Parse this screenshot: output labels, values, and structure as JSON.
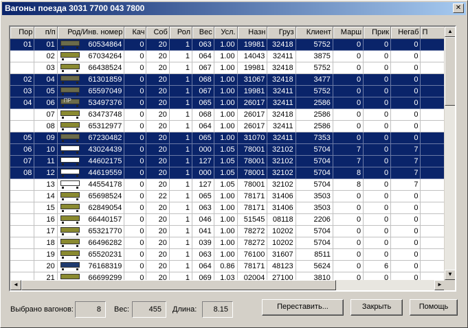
{
  "window": {
    "title": "Вагоны поезда   3031  7700 043 7800",
    "close_glyph": "✕"
  },
  "columns": [
    "Пор",
    "п/п",
    "Род/Инв. номер",
    "Кач",
    "Соб",
    "Рол",
    "Вес",
    "Усл.",
    "Назн",
    "Груз",
    "Клиент",
    "Марш",
    "Прик",
    "Негаб",
    "П"
  ],
  "rows": [
    {
      "selected": true,
      "por": "01",
      "pp": "01",
      "car_color": "#6b6b4a",
      "car_text": "",
      "inv": "60534864",
      "kach": "0",
      "sob": "20",
      "rol": "1",
      "ves": "063",
      "usl": "1.00",
      "nazn": "19981",
      "gruz": "32418",
      "client": "5752",
      "marsh": "0",
      "prik": "0",
      "negab": "0"
    },
    {
      "selected": false,
      "por": "",
      "pp": "02",
      "car_color": "#8a8a30",
      "car_text": "",
      "inv": "67034264",
      "kach": "0",
      "sob": "20",
      "rol": "1",
      "ves": "064",
      "usl": "1.00",
      "nazn": "14043",
      "gruz": "32411",
      "client": "3875",
      "marsh": "0",
      "prik": "0",
      "negab": "0"
    },
    {
      "selected": false,
      "por": "",
      "pp": "03",
      "car_color": "#8a8a30",
      "car_text": "",
      "inv": "66438524",
      "kach": "0",
      "sob": "20",
      "rol": "1",
      "ves": "067",
      "usl": "1.00",
      "nazn": "19981",
      "gruz": "32418",
      "client": "5752",
      "marsh": "0",
      "prik": "0",
      "negab": "0"
    },
    {
      "selected": true,
      "por": "02",
      "pp": "04",
      "car_color": "#6b6b4a",
      "car_text": "",
      "inv": "61301859",
      "kach": "0",
      "sob": "20",
      "rol": "1",
      "ves": "068",
      "usl": "1.00",
      "nazn": "31067",
      "gruz": "32418",
      "client": "3477",
      "marsh": "0",
      "prik": "0",
      "negab": "0"
    },
    {
      "selected": true,
      "por": "03",
      "pp": "05",
      "car_color": "#6b6b4a",
      "car_text": "",
      "inv": "65597049",
      "kach": "0",
      "sob": "20",
      "rol": "1",
      "ves": "067",
      "usl": "1.00",
      "nazn": "19981",
      "gruz": "32411",
      "client": "5752",
      "marsh": "0",
      "prik": "0",
      "negab": "0"
    },
    {
      "selected": true,
      "por": "04",
      "pp": "06",
      "car_color": "#6b6b4a",
      "car_text": "ПР",
      "inv": "53497376",
      "kach": "0",
      "sob": "20",
      "rol": "1",
      "ves": "065",
      "usl": "1.00",
      "nazn": "26017",
      "gruz": "32411",
      "client": "2586",
      "marsh": "0",
      "prik": "0",
      "negab": "0"
    },
    {
      "selected": false,
      "por": "",
      "pp": "07",
      "car_color": "#8a8a30",
      "car_text": "",
      "inv": "63473748",
      "kach": "0",
      "sob": "20",
      "rol": "1",
      "ves": "068",
      "usl": "1.00",
      "nazn": "26017",
      "gruz": "32418",
      "client": "2586",
      "marsh": "0",
      "prik": "0",
      "negab": "0"
    },
    {
      "selected": false,
      "por": "",
      "pp": "08",
      "car_color": "#8a8a30",
      "car_text": "",
      "inv": "65312977",
      "kach": "0",
      "sob": "20",
      "rol": "1",
      "ves": "064",
      "usl": "1.00",
      "nazn": "26017",
      "gruz": "32411",
      "client": "2586",
      "marsh": "0",
      "prik": "0",
      "negab": "0"
    },
    {
      "selected": true,
      "por": "05",
      "pp": "09",
      "car_color": "#6b6b4a",
      "car_text": "",
      "inv": "67230482",
      "kach": "0",
      "sob": "20",
      "rol": "1",
      "ves": "065",
      "usl": "1.00",
      "nazn": "31070",
      "gruz": "32411",
      "client": "7353",
      "marsh": "0",
      "prik": "0",
      "negab": "0"
    },
    {
      "selected": true,
      "por": "06",
      "pp": "10",
      "car_color": "#ffffff",
      "car_text": "",
      "inv": "43024439",
      "kach": "0",
      "sob": "20",
      "rol": "1",
      "ves": "000",
      "usl": "1.05",
      "nazn": "78001",
      "gruz": "32102",
      "client": "5704",
      "marsh": "7",
      "prik": "0",
      "negab": "7"
    },
    {
      "selected": true,
      "por": "07",
      "pp": "11",
      "car_color": "#ffffff",
      "car_text": "",
      "inv": "44602175",
      "kach": "0",
      "sob": "20",
      "rol": "1",
      "ves": "127",
      "usl": "1.05",
      "nazn": "78001",
      "gruz": "32102",
      "client": "5704",
      "marsh": "7",
      "prik": "0",
      "negab": "7"
    },
    {
      "selected": true,
      "por": "08",
      "pp": "12",
      "car_color": "#ffffff",
      "car_text": "",
      "inv": "44619559",
      "kach": "0",
      "sob": "20",
      "rol": "1",
      "ves": "000",
      "usl": "1.05",
      "nazn": "78001",
      "gruz": "32102",
      "client": "5704",
      "marsh": "8",
      "prik": "0",
      "negab": "7"
    },
    {
      "selected": false,
      "por": "",
      "pp": "13",
      "car_color": "#ffffff",
      "car_text": "",
      "inv": "44554178",
      "kach": "0",
      "sob": "20",
      "rol": "1",
      "ves": "127",
      "usl": "1.05",
      "nazn": "78001",
      "gruz": "32102",
      "client": "5704",
      "marsh": "8",
      "prik": "0",
      "negab": "7"
    },
    {
      "selected": false,
      "por": "",
      "pp": "14",
      "car_color": "#8a8a30",
      "car_text": "",
      "inv": "65698524",
      "kach": "0",
      "sob": "22",
      "rol": "1",
      "ves": "065",
      "usl": "1.00",
      "nazn": "78171",
      "gruz": "31406",
      "client": "3503",
      "marsh": "0",
      "prik": "0",
      "negab": "0"
    },
    {
      "selected": false,
      "por": "",
      "pp": "15",
      "car_color": "#8a8a30",
      "car_text": "",
      "inv": "62849054",
      "kach": "0",
      "sob": "20",
      "rol": "1",
      "ves": "063",
      "usl": "1.00",
      "nazn": "78171",
      "gruz": "31406",
      "client": "3503",
      "marsh": "0",
      "prik": "0",
      "negab": "0"
    },
    {
      "selected": false,
      "por": "",
      "pp": "16",
      "car_color": "#8a8a30",
      "car_text": "",
      "inv": "66440157",
      "kach": "0",
      "sob": "20",
      "rol": "1",
      "ves": "046",
      "usl": "1.00",
      "nazn": "51545",
      "gruz": "08118",
      "client": "2206",
      "marsh": "0",
      "prik": "0",
      "negab": "0"
    },
    {
      "selected": false,
      "por": "",
      "pp": "17",
      "car_color": "#8a8a30",
      "car_text": "",
      "inv": "65321770",
      "kach": "0",
      "sob": "20",
      "rol": "1",
      "ves": "041",
      "usl": "1.00",
      "nazn": "78272",
      "gruz": "10202",
      "client": "5704",
      "marsh": "0",
      "prik": "0",
      "negab": "0"
    },
    {
      "selected": false,
      "por": "",
      "pp": "18",
      "car_color": "#8a8a30",
      "car_text": "",
      "inv": "66496282",
      "kach": "0",
      "sob": "20",
      "rol": "1",
      "ves": "039",
      "usl": "1.00",
      "nazn": "78272",
      "gruz": "10202",
      "client": "5704",
      "marsh": "0",
      "prik": "0",
      "negab": "0"
    },
    {
      "selected": false,
      "por": "",
      "pp": "19",
      "car_color": "#8a8a30",
      "car_text": "",
      "inv": "65520231",
      "kach": "0",
      "sob": "20",
      "rol": "1",
      "ves": "063",
      "usl": "1.00",
      "nazn": "76100",
      "gruz": "31607",
      "client": "8511",
      "marsh": "0",
      "prik": "0",
      "negab": "0"
    },
    {
      "selected": false,
      "por": "",
      "pp": "20",
      "car_color": "#1f3a6e",
      "car_text": "",
      "inv": "76168319",
      "kach": "0",
      "sob": "20",
      "rol": "1",
      "ves": "064",
      "usl": "0.86",
      "nazn": "78171",
      "gruz": "48123",
      "client": "5624",
      "marsh": "0",
      "prik": "6",
      "negab": "0"
    },
    {
      "selected": false,
      "por": "",
      "pp": "21",
      "car_color": "#8a8a30",
      "car_text": "",
      "inv": "66699299",
      "kach": "0",
      "sob": "20",
      "rol": "1",
      "ves": "069",
      "usl": "1.03",
      "nazn": "02004",
      "gruz": "27100",
      "client": "3810",
      "marsh": "0",
      "prik": "0",
      "negab": "0"
    }
  ],
  "status": {
    "selected_label": "Выбрано вагонов:",
    "selected_value": "8",
    "weight_label": "Вес:",
    "weight_value": "455",
    "length_label": "Длина:",
    "length_value": "8.15"
  },
  "buttons": {
    "reorder": "Переставить...",
    "close": "Закрыть",
    "help": "Помощь"
  },
  "scroll": {
    "up": "▲",
    "down": "▼",
    "left": "◄",
    "right": "►"
  },
  "colors": {
    "selection": "#0a246a",
    "title_start": "#0a246a",
    "title_end": "#a6caf0",
    "dialog_bg": "#d4d0c8"
  }
}
